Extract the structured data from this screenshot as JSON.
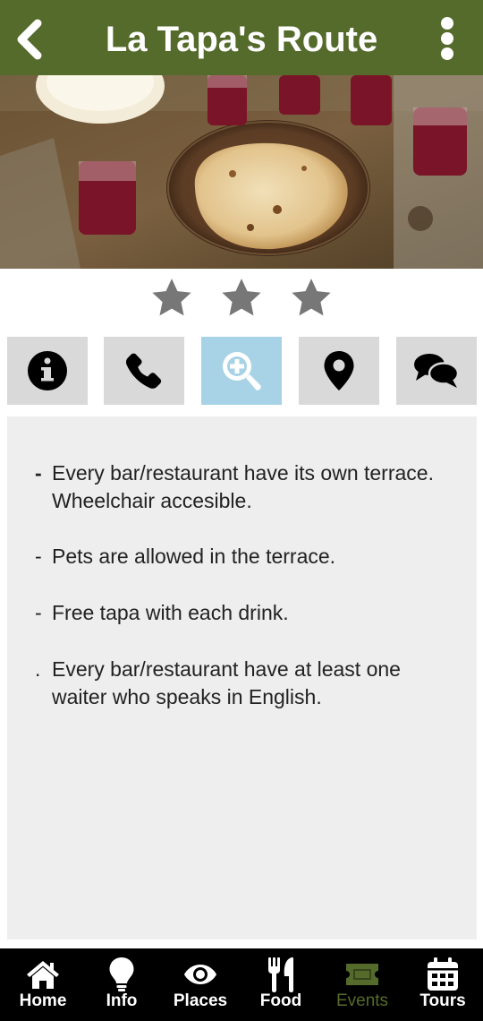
{
  "header": {
    "title": "La Tapa's Route",
    "back_icon": "chevron-left-icon",
    "menu_icon": "kebab-menu-icon",
    "bg_color": "#556b2b"
  },
  "hero": {
    "alt": "Tapas and glasses of red wine on a wooden board"
  },
  "rating": {
    "stars": 3,
    "color": "#777777"
  },
  "tabs": [
    {
      "icon": "info-icon"
    },
    {
      "icon": "phone-icon"
    },
    {
      "icon": "zoom-in-icon",
      "active": true
    },
    {
      "icon": "location-pin-icon"
    },
    {
      "icon": "comments-icon"
    }
  ],
  "details": [
    {
      "mark": "-",
      "text": "Every bar/restaurant have its own terrace. Wheelchair accesible."
    },
    {
      "mark": "-",
      "text": "Pets are allowed in the terrace."
    },
    {
      "mark": "-",
      "text": "Free tapa with each drink."
    },
    {
      "mark": ".",
      "text": "Every bar/restaurant have at least one waiter who speaks in English."
    }
  ],
  "nav": [
    {
      "label": "Home",
      "icon": "home-icon"
    },
    {
      "label": "Info",
      "icon": "lightbulb-icon"
    },
    {
      "label": "Places",
      "icon": "eye-icon"
    },
    {
      "label": "Food",
      "icon": "fork-knife-icon"
    },
    {
      "label": "Events",
      "icon": "ticket-icon",
      "active": true
    },
    {
      "label": "Tours",
      "icon": "calendar-icon"
    }
  ],
  "colors": {
    "accent": "#556b2b",
    "active_tab": "#a8d2e6",
    "tab_bg": "#d9d9d9",
    "panel_bg": "#eeeeee"
  }
}
